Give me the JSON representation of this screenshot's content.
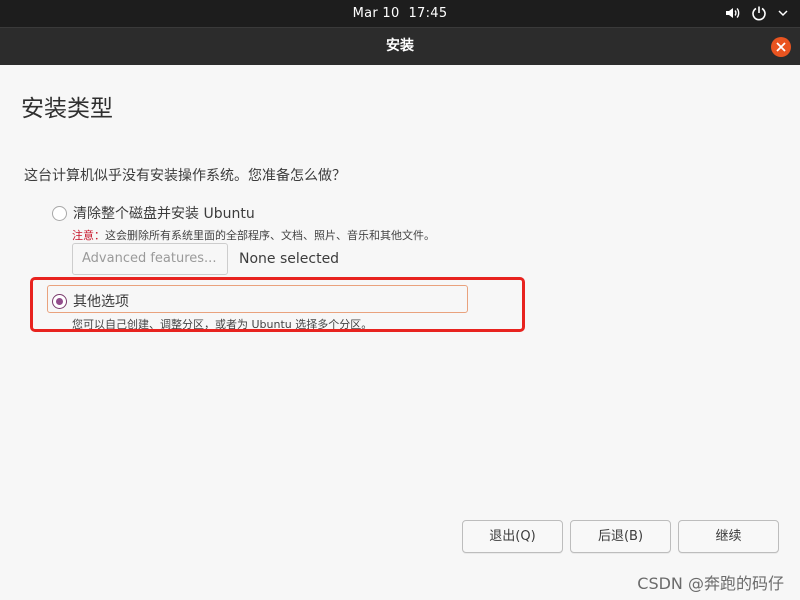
{
  "topbar": {
    "date": "Mar 10",
    "time": "17:45"
  },
  "window": {
    "title": "安装"
  },
  "page": {
    "heading": "安装类型",
    "question": "这台计算机似乎没有安装操作系统。您准备怎么做？",
    "options": [
      {
        "label": "清除整个磁盘并安装 Ubuntu",
        "selected": false,
        "note_warn": "注意：",
        "note": "这会删除所有系统里面的全部程序、文档、照片、音乐和其他文件。",
        "advanced_button": "Advanced features...",
        "advanced_status": "None selected"
      },
      {
        "label": "其他选项",
        "selected": true,
        "note": "您可以自己创建、调整分区，或者为 Ubuntu 选择多个分区。"
      }
    ]
  },
  "buttons": {
    "quit": "退出(Q)",
    "back": "后退(B)",
    "continue": "继续"
  },
  "watermark": "CSDN @奔跑的码仔",
  "colors": {
    "accent": "#e95420",
    "radio": "#924d8b",
    "warning": "#c7162b",
    "annotation": "#e8231f"
  }
}
